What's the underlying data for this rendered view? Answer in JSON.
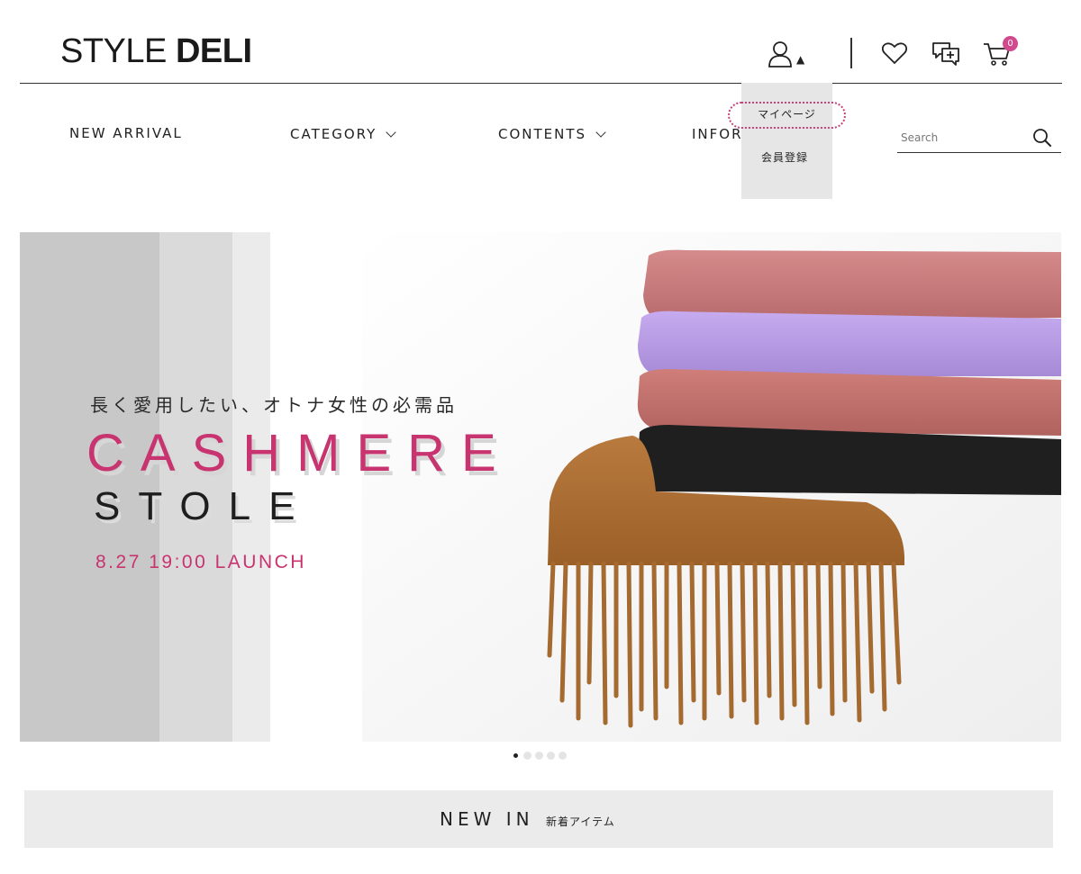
{
  "header": {
    "logo_light": "STYLE",
    "logo_bold": "DELI",
    "cart_count": "0",
    "colors": {
      "accent": "#d24a8e",
      "text": "#222222"
    },
    "icons": [
      "user-icon",
      "caret-up-icon",
      "heart-icon",
      "chat-icon",
      "cart-icon"
    ]
  },
  "nav": {
    "items": [
      {
        "label": "NEW ARRIVAL"
      },
      {
        "label": "CATEGORY"
      },
      {
        "label": "CONTENTS"
      },
      {
        "label": "INFORMATION"
      }
    ]
  },
  "dropdown": {
    "items": [
      {
        "label": "マイページ"
      },
      {
        "label": "会員登録"
      }
    ]
  },
  "search": {
    "placeholder": "Search",
    "value": ""
  },
  "hero": {
    "subtitle": "長く愛用したい、オトナ女性の必需品",
    "title_line1": "CASHMERE",
    "title_line2": "STOLE",
    "date": "8.27 19:00 LAUNCH",
    "accent_color": "#c8346f",
    "slide_index": 1,
    "slide_count": 5
  },
  "section": {
    "title": "NEW IN",
    "subtitle": "新着アイテム"
  }
}
